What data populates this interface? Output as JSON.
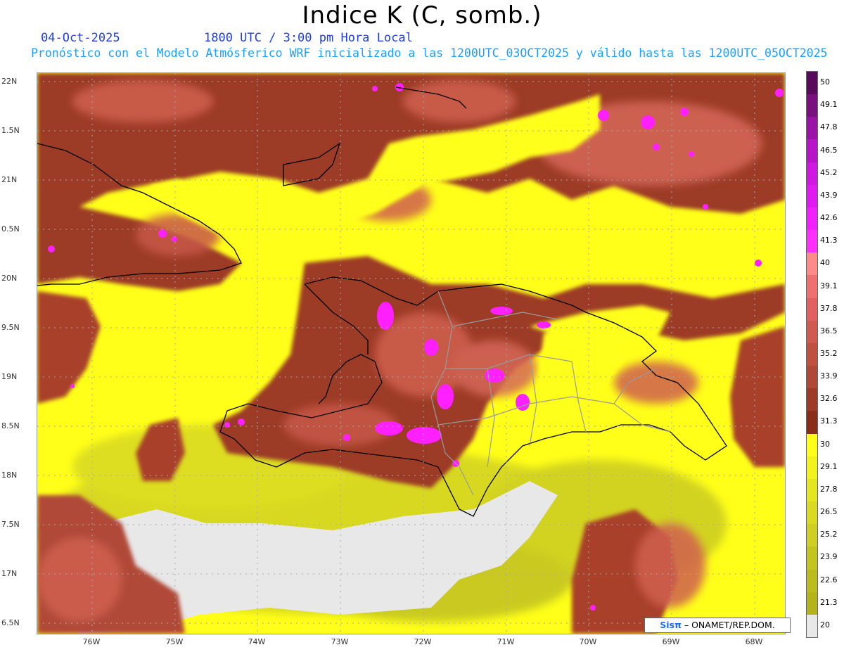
{
  "header": {
    "title": "Indice K (C, somb.)",
    "date": "04-Oct-2025",
    "time": "1800 UTC / 3:00 pm Hora Local",
    "subtitle": "Pronóstico con el Modelo Atmósferico WRF inicializado a las 1200UTC_03OCT2025 y válido hasta las  1200UTC_05OCT2025"
  },
  "axes": {
    "lat_labels": [
      "22N",
      "1.5N",
      "21N",
      "0.5N",
      "20N",
      "9.5N",
      "19N",
      "8.5N",
      "18N",
      "7.5N",
      "17N",
      "6.5N"
    ],
    "lon_labels": [
      "76W",
      "75W",
      "74W",
      "73W",
      "72W",
      "71W",
      "70W",
      "69W",
      "68W"
    ]
  },
  "colorbar": {
    "labels": [
      "50",
      "49.1",
      "47.8",
      "46.5",
      "45.2",
      "43.9",
      "42.6",
      "41.3",
      "40",
      "39.1",
      "37.8",
      "36.5",
      "35.2",
      "33.9",
      "32.6",
      "31.3",
      "30",
      "29.1",
      "27.8",
      "26.5",
      "25.2",
      "23.9",
      "22.6",
      "21.3",
      "20"
    ],
    "colors": [
      "#5a0a5a",
      "#7a1080",
      "#9a12a8",
      "#b814c8",
      "#d018e0",
      "#e01af0",
      "#f020ff",
      "#ff30ff",
      "#ff8a8a",
      "#f07070",
      "#e26060",
      "#d05a50",
      "#c05040",
      "#b04838",
      "#a03a28",
      "#8a2e1a",
      "#ffff1a",
      "#f2f21c",
      "#e6e620",
      "#dada22",
      "#cece24",
      "#c4c420",
      "#bcbc1e",
      "#b4b41a",
      "#e8e8e8"
    ]
  },
  "credit": {
    "logo": "Sisπ",
    "text": "– ONAMET/REP.DOM."
  }
}
